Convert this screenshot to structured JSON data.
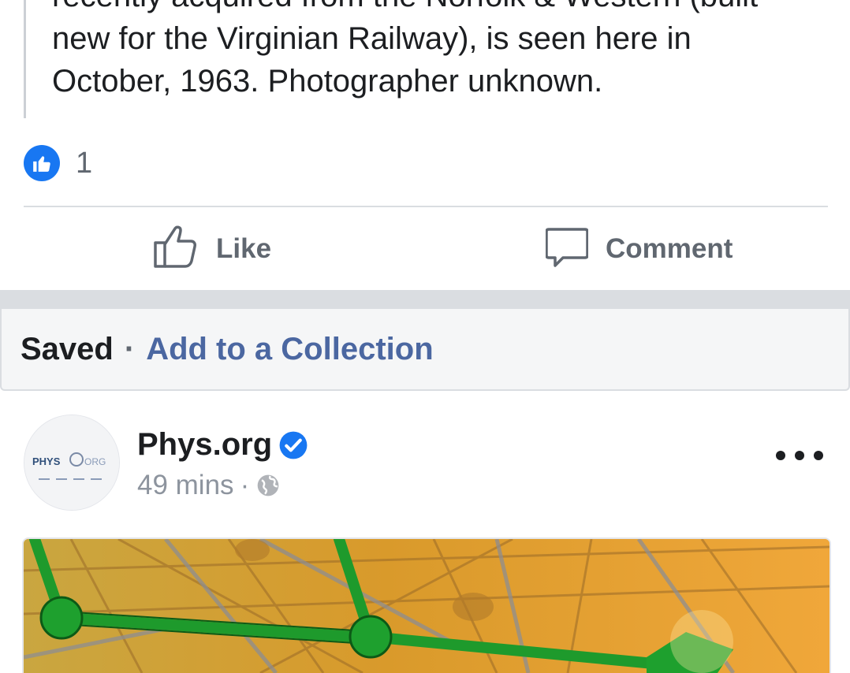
{
  "quote": {
    "lines": [
      "recently acquired from the Norfolk & Western (built",
      "new for the Virginian Railway), is seen here in",
      "October, 1963. Photographer unknown."
    ]
  },
  "reactions": {
    "icon": "like-reaction-icon",
    "count": "1",
    "color": "#1877f2"
  },
  "actions": {
    "like_label": "Like",
    "like_icon": "thumbs-up-outline-icon",
    "comment_label": "Comment",
    "comment_icon": "speech-bubble-icon"
  },
  "saved_bar": {
    "status": "Saved",
    "separator": "·",
    "link": "Add to a Collection",
    "link_color": "#4b67a1"
  },
  "post": {
    "page_name": "Phys.org",
    "verified_icon": "verified-badge-icon",
    "time": "49 mins",
    "separator": "·",
    "audience_icon": "globe-icon",
    "avatar_logo_text": "PHYS ORG",
    "more_icon": "more-options-icon",
    "image_description_icon": "network-map-image"
  }
}
